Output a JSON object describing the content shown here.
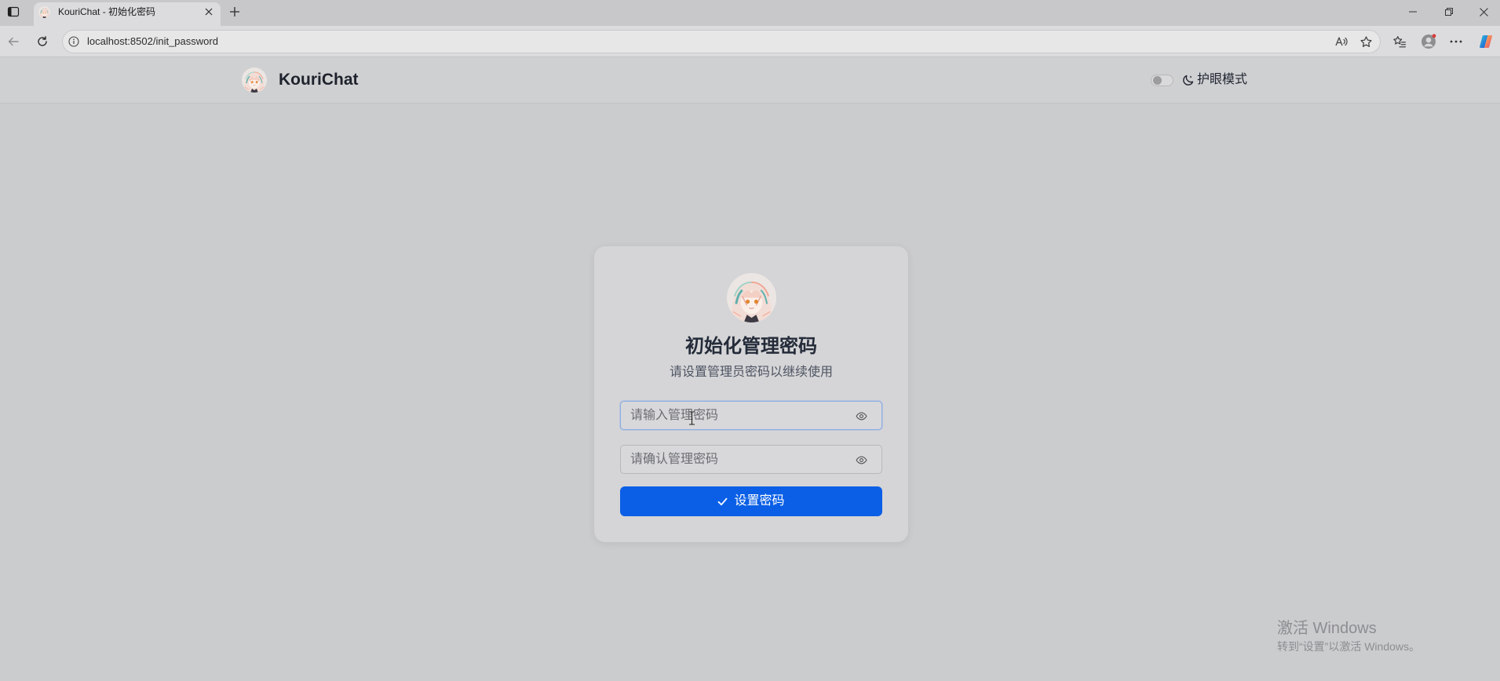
{
  "browser": {
    "tab": {
      "title": "KouriChat - 初始化密码",
      "favicon": "kourichat-favicon"
    },
    "address_bar": {
      "url": "localhost:8502/init_password"
    },
    "icons": {
      "tab_actions": "tab-actions-icon",
      "close_tab": "close-icon",
      "new_tab": "plus-icon",
      "minimize": "minimize-icon",
      "restore": "restore-icon",
      "close_window": "close-window-icon",
      "back": "arrow-left-icon",
      "reload": "reload-icon",
      "site_info": "info-icon",
      "read_aloud": "read-aloud-icon",
      "favorite": "star-icon",
      "favorites": "favorites-icon",
      "profile": "profile-icon",
      "more": "more-icon",
      "copilot": "copilot-icon"
    }
  },
  "navbar": {
    "brand": "KouriChat",
    "eye_mode": {
      "label": "护眼模式",
      "enabled": false,
      "icon": "moon-icon"
    }
  },
  "card": {
    "title": "初始化管理密码",
    "subtitle": "请设置管理员密码以继续使用",
    "password_field": {
      "placeholder": "请输入管理密码",
      "value": "",
      "focused": true,
      "icon": "eye-icon"
    },
    "confirm_field": {
      "placeholder": "请确认管理密码",
      "value": "",
      "icon": "eye-icon"
    },
    "submit": {
      "label": "设置密码",
      "icon": "check-icon"
    }
  },
  "watermark": {
    "line1": "激活 Windows",
    "line2": "转到“设置”以激活 Windows。"
  },
  "colors": {
    "accent": "#0a5fe6",
    "focus_border": "#8aaee6",
    "page_bg": "#cbccce",
    "card_bg": "#d5d5d7"
  }
}
